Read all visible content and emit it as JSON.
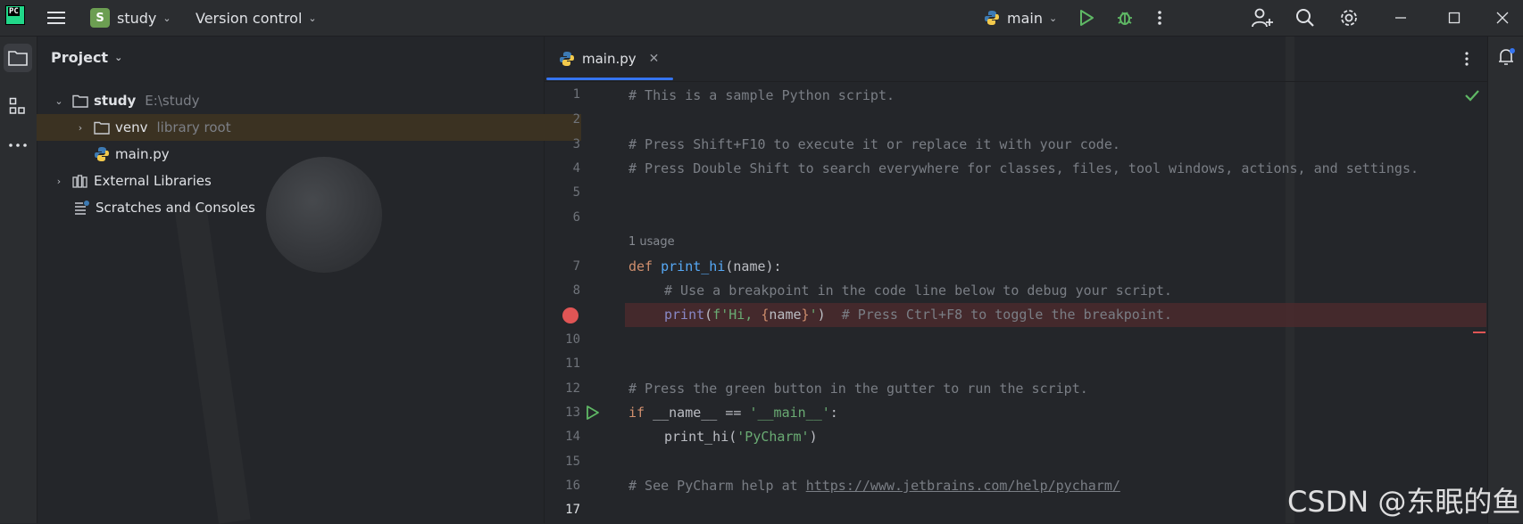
{
  "titlebar": {
    "project_badge": "S",
    "project_name": "study",
    "vcs_label": "Version control",
    "run_config": "main"
  },
  "project_panel": {
    "title": "Project",
    "tree": [
      {
        "label": "study",
        "hint": "E:\\study"
      },
      {
        "label": "venv",
        "hint": "library root"
      },
      {
        "label": "main.py"
      },
      {
        "label": "External Libraries"
      },
      {
        "label": "Scratches and Consoles"
      }
    ]
  },
  "editor": {
    "tab_label": "main.py",
    "line_numbers": [
      "1",
      "2",
      "3",
      "4",
      "5",
      "6",
      "7",
      "8",
      "10",
      "11",
      "12",
      "13",
      "14",
      "15",
      "16",
      "17"
    ],
    "usage_hint": "1 usage",
    "lines": {
      "l1": "# This is a sample Python script.",
      "l3": "# Press Shift+F10 to execute it or replace it with your code.",
      "l4": "# Press Double Shift to search everywhere for classes, files, tool windows, actions, and settings.",
      "l7_kw": "def",
      "l7_fn": "print_hi",
      "l7_rest": "(name):",
      "l8": "# Use a breakpoint in the code line below to debug your script.",
      "l9_fn": "print",
      "l9_a": "(",
      "l9_s1": "f'Hi, ",
      "l9_b1": "{",
      "l9_var": "name",
      "l9_b2": "}",
      "l9_s2": "'",
      "l9_c": ")",
      "l9_cmt": "# Press Ctrl+F8 to toggle the breakpoint.",
      "l12": "# Press the green button in the gutter to run the script.",
      "l13_kw": "if",
      "l13_mid": " __name__ == ",
      "l13_str": "'__main__'",
      "l13_end": ":",
      "l14_fn": "print_hi",
      "l14_a": "(",
      "l14_str": "'PyCharm'",
      "l14_b": ")",
      "l16_cmt": "# See PyCharm help at ",
      "l16_link": "https://www.jetbrains.com/help/pycharm/"
    }
  },
  "watermark": "CSDN @东眠的鱼",
  "colors": {
    "accent": "#3574f0",
    "run_green": "#5fb865",
    "breakpoint_red": "#e05555"
  },
  "icons": [
    "pycharm-logo-icon",
    "hamburger-menu-icon",
    "chevron-down-icon",
    "python-icon",
    "run-icon",
    "debug-icon",
    "more-vertical-icon",
    "add-user-icon",
    "search-icon",
    "settings-icon",
    "minimize-icon",
    "maximize-icon",
    "close-icon",
    "folder-icon",
    "structure-icon",
    "more-horizontal-icon",
    "notifications-icon",
    "checkmark-icon",
    "breakpoint-icon",
    "run-gutter-icon"
  ]
}
